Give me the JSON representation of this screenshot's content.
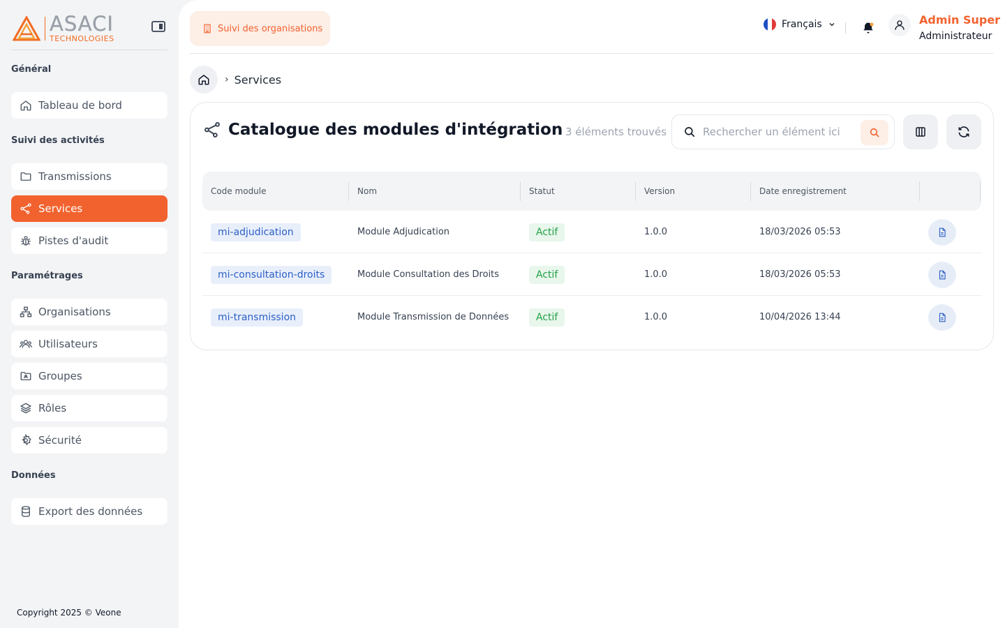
{
  "brand": {
    "name": "ASACI",
    "subtitle": "TECHNOLOGIES"
  },
  "sidebar": {
    "sections": [
      {
        "title": "Général"
      },
      {
        "title": "Suivi des activités"
      },
      {
        "title": "Paramétrages"
      },
      {
        "title": "Données"
      }
    ],
    "items": [
      {
        "label": "Tableau de bord",
        "icon": "home-icon"
      },
      {
        "label": "Transmissions",
        "icon": "folder-icon"
      },
      {
        "label": "Services",
        "icon": "share-icon",
        "active": true
      },
      {
        "label": "Pistes d'audit",
        "icon": "bug-icon"
      },
      {
        "label": "Organisations",
        "icon": "sitemap-icon"
      },
      {
        "label": "Utilisateurs",
        "icon": "users-icon"
      },
      {
        "label": "Groupes",
        "icon": "folder-group-icon"
      },
      {
        "label": "Rôles",
        "icon": "layers-icon"
      },
      {
        "label": "Sécurité",
        "icon": "gear-icon"
      },
      {
        "label": "Export des données",
        "icon": "database-icon"
      }
    ],
    "copyright": "Copyright 2025 © Veone"
  },
  "header": {
    "org_button": "Suivi des organisations",
    "language": "Français",
    "user_name": "Admin Super",
    "user_role": "Administrateur"
  },
  "breadcrumb": {
    "current": "Services"
  },
  "catalog": {
    "title": "Catalogue des modules d'intégration",
    "count": "3 éléments trouvés",
    "search_placeholder": "Rechercher un élément ici",
    "columns": [
      "Code module",
      "Nom",
      "Statut",
      "Version",
      "Date enregistrement"
    ],
    "rows": [
      {
        "code": "mi-adjudication",
        "name": "Module Adjudication",
        "status": "Actif",
        "version": "1.0.0",
        "date": "18/03/2026 05:53"
      },
      {
        "code": "mi-consultation-droits",
        "name": "Module Consultation des Droits",
        "status": "Actif",
        "version": "1.0.0",
        "date": "18/03/2026 05:53"
      },
      {
        "code": "mi-transmission",
        "name": "Module Transmission de Données",
        "status": "Actif",
        "version": "1.0.0",
        "date": "10/04/2026 13:44"
      }
    ]
  },
  "colors": {
    "accent": "#f2622e",
    "code_badge": "#2c5fc4",
    "status_active": "#22a046"
  }
}
